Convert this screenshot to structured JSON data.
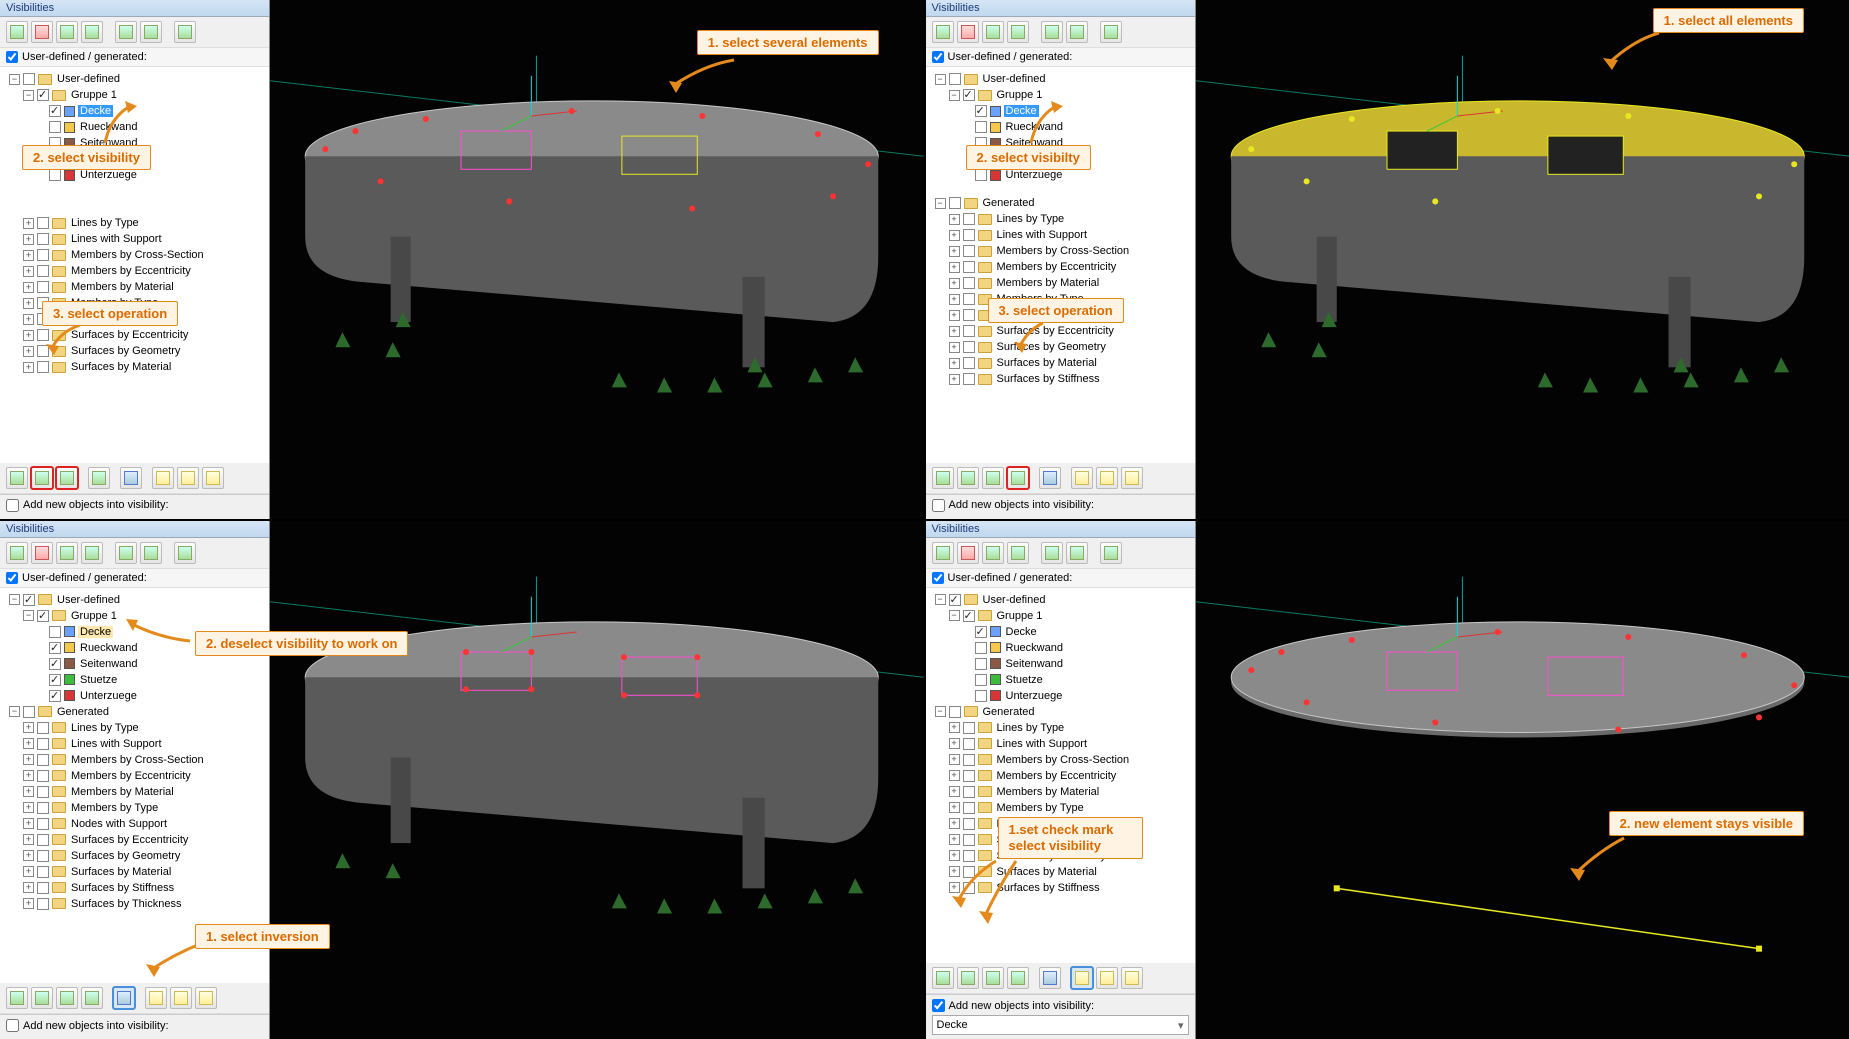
{
  "panel_title": "Visibilities",
  "userdef_label": "User-defined / generated:",
  "add_new_label": "Add new objects into visibility:",
  "dropdown_value": "Decke",
  "tree_userdef": "User-defined",
  "tree_group1": "Gruppe 1",
  "members": {
    "decke": "Decke",
    "rueckwand": "Rueckwand",
    "seitenwand": "Seitenwand",
    "stuetze": "Stuetze",
    "unterzuege": "Unterzuege"
  },
  "tree_generated": "Generated",
  "gen_items": [
    "Lines by Type",
    "Lines with Support",
    "Members by Cross-Section",
    "Members by Eccentricity",
    "Members by Material",
    "Members by Type",
    "Nodes with Support",
    "Surfaces by Eccentricity",
    "Surfaces by Geometry",
    "Surfaces by Material",
    "Surfaces by Stiffness",
    "Surfaces by Thickness"
  ],
  "callouts": {
    "q1_a": "1. select several elements",
    "q1_b": "2. select visibility",
    "q1_c": "3. select operation",
    "q2_a": "1. select all elements",
    "q2_b": "2. select visibilty",
    "q2_c": "3. select operation",
    "q3_a": "1. select inversion",
    "q3_b": "2. deselect visibility to work on",
    "q4_a": "1.set check mark select visibility",
    "q4_b": "2. new element stays visible"
  },
  "colors": {
    "decke": "#6aa1ff",
    "rueckwand": "#f5c84b",
    "seitenwand": "#8a5a44",
    "stuetze": "#3dbb3d",
    "unterzuege": "#d63636"
  },
  "chart_data": null
}
